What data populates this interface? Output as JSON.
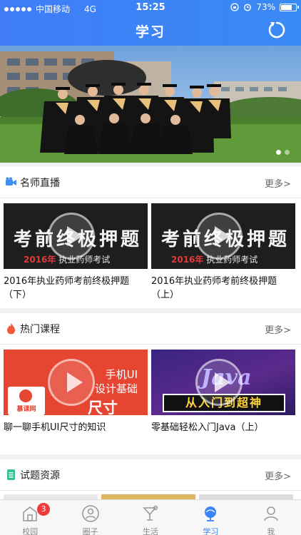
{
  "status_bar": {
    "carrier": "中国移动",
    "network": "4G",
    "time": "15:25",
    "battery": "73%",
    "battery_level": 0.73
  },
  "nav": {
    "title": "学习",
    "refresh_icon": "refresh-icon"
  },
  "banner": {
    "slide_count": 2,
    "active_slide": 1
  },
  "live": {
    "title": "名师直播",
    "more": "更多>",
    "icon": "video-camera-icon",
    "items": [
      {
        "thumb_title": "考前终极押题",
        "thumb_year": "2016年",
        "thumb_sub": "执业药师考试",
        "caption": "2016年执业药师考前终极押题（下）"
      },
      {
        "thumb_title": "考前终极押题",
        "thumb_year": "2016年",
        "thumb_sub": "执业药师考试",
        "caption": "2016年执业药师考前终极押题（上）"
      }
    ]
  },
  "hot": {
    "title": "热门课程",
    "more": "更多>",
    "icon": "flame-icon",
    "items": [
      {
        "line1": "手机UI",
        "line2": "设计基础",
        "line3": "尺寸",
        "logo_text": "慕课网",
        "caption": "聊一聊手机UI尺寸的知识"
      },
      {
        "java": "Java",
        "banner_text": "从入门到超神",
        "caption": "零基础轻松入门Java（上）"
      }
    ]
  },
  "exam": {
    "title": "试题资源",
    "more": "更多>",
    "icon": "document-icon"
  },
  "tabs": [
    {
      "label": "校园",
      "icon": "school-icon",
      "badge": "3"
    },
    {
      "label": "圈子",
      "icon": "circle-person-icon"
    },
    {
      "label": "生活",
      "icon": "cocktail-icon"
    },
    {
      "label": "学习",
      "icon": "globe-icon",
      "active": true
    },
    {
      "label": "我",
      "icon": "user-icon"
    }
  ],
  "colors": {
    "primary": "#3b82f6",
    "badge": "#ee3b3b",
    "flame": "#f05a3a"
  }
}
